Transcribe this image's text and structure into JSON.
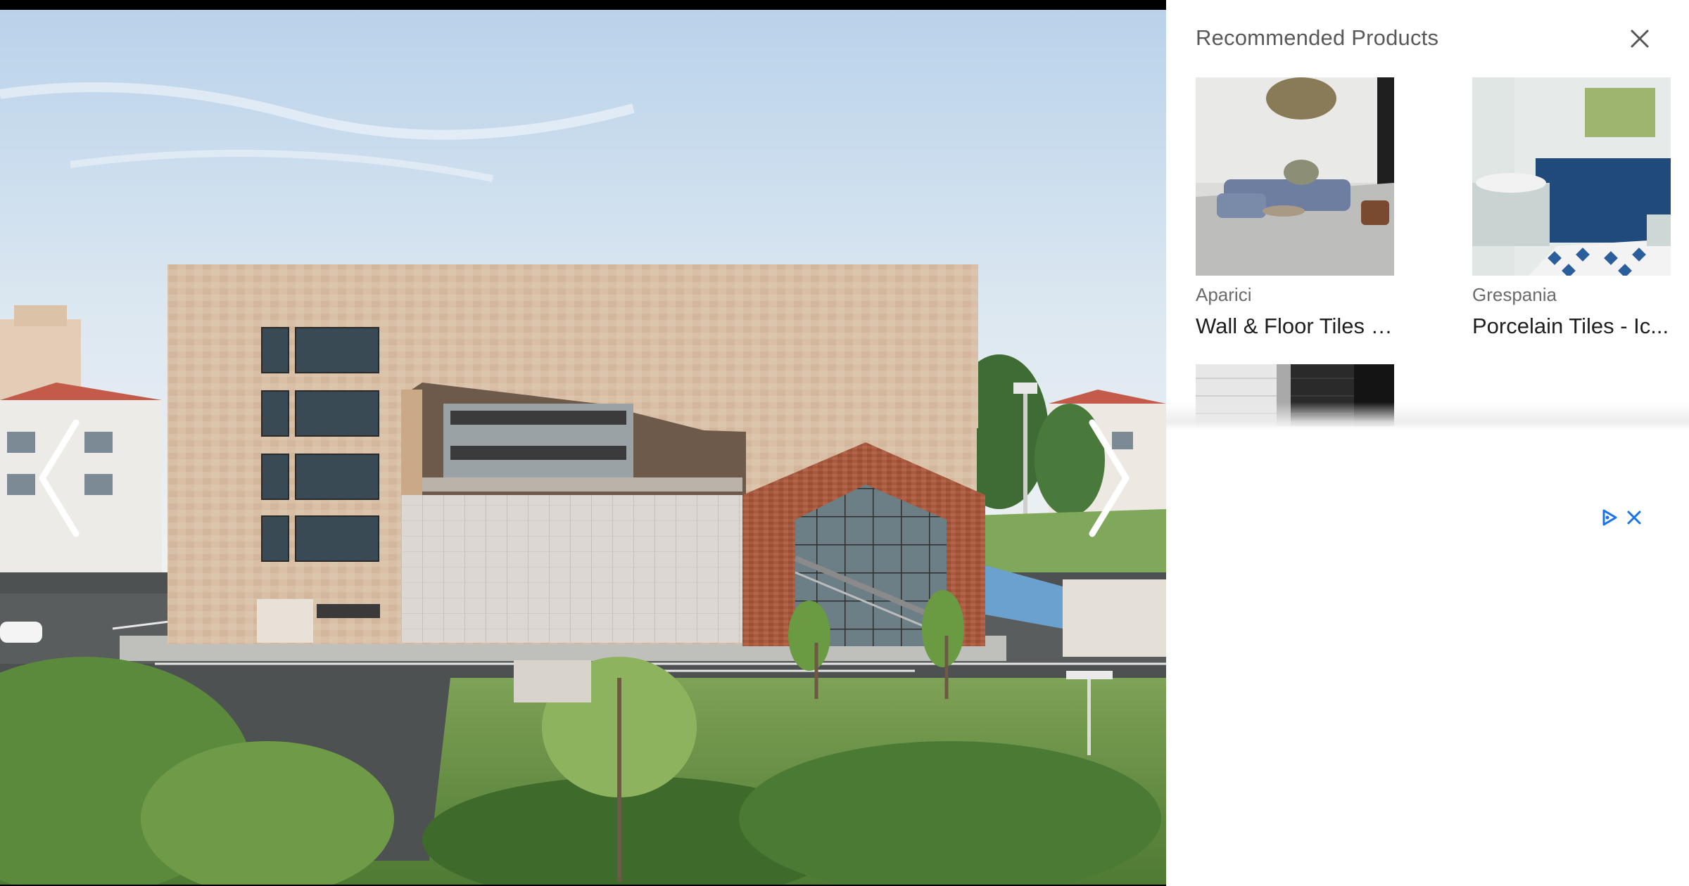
{
  "gallery": {
    "prev_label": "Previous image",
    "next_label": "Next image"
  },
  "panel": {
    "title": "Recommended Products",
    "close_icon": "close-icon",
    "products": [
      {
        "brand": "Aparici",
        "name": "Wall & Floor Tiles -...",
        "thumb": "living-room-tiles"
      },
      {
        "brand": "Grespania",
        "name": "Porcelain Tiles - Ic...",
        "thumb": "bathroom-blue-tiles"
      },
      {
        "brand": "",
        "name": "",
        "thumb": "white-black-brick-tiles"
      }
    ]
  },
  "ad": {
    "adchoices_icon": "adchoices-icon",
    "close_icon": "close-icon"
  },
  "colors": {
    "accent_blue": "#1a73e8",
    "title_gray": "#595959",
    "brand_gray": "#6b6b6b",
    "name_dark": "#1e1e1e"
  }
}
